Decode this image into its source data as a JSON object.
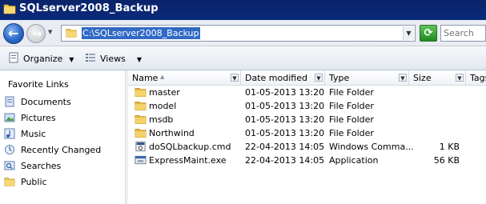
{
  "window": {
    "title": "SQLserver2008_Backup"
  },
  "address": {
    "path": "C:\\SQLserver2008_Backup"
  },
  "search": {
    "placeholder": "Search"
  },
  "toolbar": {
    "organize_label": "Organize",
    "views_label": "Views"
  },
  "favorites": {
    "heading": "Favorite Links",
    "items": [
      {
        "label": "Documents",
        "icon": "documents-icon"
      },
      {
        "label": "Pictures",
        "icon": "pictures-icon"
      },
      {
        "label": "Music",
        "icon": "music-icon"
      },
      {
        "label": "Recently Changed",
        "icon": "recently-changed-icon"
      },
      {
        "label": "Searches",
        "icon": "searches-icon"
      },
      {
        "label": "Public",
        "icon": "public-folder-icon"
      }
    ]
  },
  "columns": {
    "name": "Name",
    "date": "Date modified",
    "type": "Type",
    "size": "Size",
    "tags": "Tags"
  },
  "files": [
    {
      "name": "master",
      "date": "01-05-2013 13:20",
      "type": "File Folder",
      "size": "",
      "icon": "folder-icon"
    },
    {
      "name": "model",
      "date": "01-05-2013 13:20",
      "type": "File Folder",
      "size": "",
      "icon": "folder-icon"
    },
    {
      "name": "msdb",
      "date": "01-05-2013 13:20",
      "type": "File Folder",
      "size": "",
      "icon": "folder-icon"
    },
    {
      "name": "Northwind",
      "date": "01-05-2013 13:20",
      "type": "File Folder",
      "size": "",
      "icon": "folder-icon"
    },
    {
      "name": "doSQLbackup.cmd",
      "date": "22-04-2013 14:05",
      "type": "Windows Comma...",
      "size": "1 KB",
      "icon": "cmd-file-icon"
    },
    {
      "name": "ExpressMaint.exe",
      "date": "22-04-2013 14:05",
      "type": "Application",
      "size": "56 KB",
      "icon": "exe-file-icon"
    }
  ],
  "colors": {
    "titlebar": "#0a246a",
    "selection": "#316ac5",
    "folder": "#e8b840"
  }
}
